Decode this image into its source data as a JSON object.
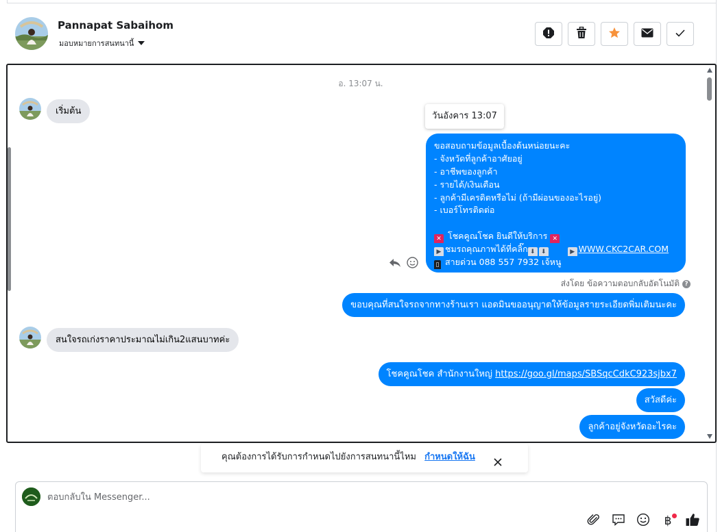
{
  "header": {
    "contact_name": "Pannapat Sabaihom",
    "assign_label": "มอบหมายการสนทนานี้"
  },
  "actions": [
    "spam-icon",
    "trash-icon",
    "star-icon",
    "envelope-icon",
    "check-icon"
  ],
  "accent_color": "#0084ff",
  "star_color": "#f7923b",
  "chat": {
    "timestamp": "อ. 13:07 น.",
    "msg_start": "เริ่มต้น",
    "tooltip": "วันอังคาร 13:07",
    "auto_reply_lines": [
      "ขอสอบถามข้อมูลเบื้องต้นหน่อยนะคะ",
      "- จังหวัดที่ลูกค้าอาศัยอยู่",
      "- อาชีพของลูกค้า",
      "- รายได้/เงินเดือน",
      "- ลูกค้ามีเครดิตหรือไม่ (ถ้ามีผ่อนของอะไรอยู่)",
      "- เบอร์โทรติดต่อ",
      ""
    ],
    "promo_line": "โชคคูณโชค ยินดีให้บริการ",
    "cta_line": "ชมรถคุณภาพได้ที่คลิ๊ก",
    "website": "WWW.CKC2CAR.COM",
    "hotline": "สายด่วน 088 557 7932 เจ้หนู",
    "sent_by": "ส่งโดย ข้อความตอบกลับอัตโนมัติ",
    "msg_thanks": "ขอบคุณที่สนใจรถจากทางร้านเรา แอดมินขออนุญาตให้ข้อมูลรายระเอียดพิ่มเติมนะคะ",
    "msg_budget": "สนใจรถเก่งราคาประมาณไม่เกิน2แสนบาทค่ะ",
    "msg_office_prefix": "โชคคูณโชค สำนักงานใหญ่",
    "msg_office_link": "https://goo.gl/maps/SBSqcCdkC923sjbx7",
    "msg_hello": "สวัสดีค่ะ",
    "msg_province": "ลูกค้าอยู่จังหวัดอะไรคะ"
  },
  "notice": {
    "text": "คุณต้องการได้รับการกำหนดไปยังการสนทนานี้ไหม",
    "link": "กำหนดให้ฉัน"
  },
  "composer": {
    "placeholder": "ตอบกลับใน Messenger...",
    "tools": [
      "paperclip-icon",
      "saved-reply-icon",
      "emoji-icon",
      "baht-icon",
      "thumbs-up-icon"
    ],
    "baht_symbol": "฿"
  }
}
